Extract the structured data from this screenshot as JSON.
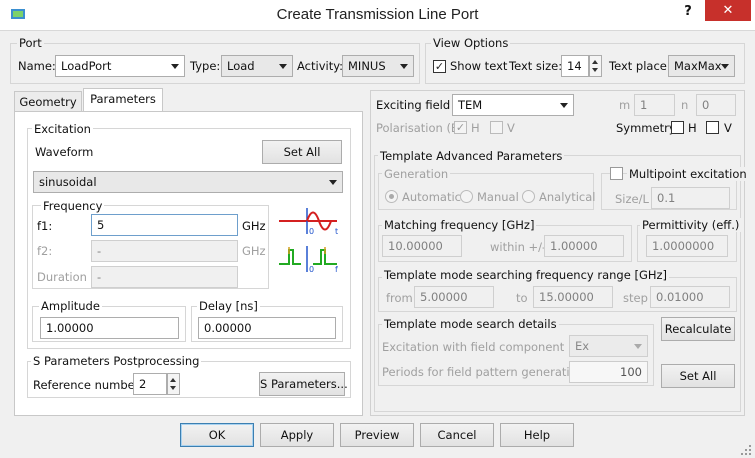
{
  "window": {
    "title": "Create Transmission Line Port",
    "help": "?",
    "close": "✕"
  },
  "port": {
    "group_label": "Port",
    "name_label": "Name:",
    "name_value": "LoadPort",
    "type_label": "Type:",
    "type_value": "Load",
    "activity_label": "Activity:",
    "activity_value": "MINUS"
  },
  "view_options": {
    "group_label": "View Options",
    "show_text_label": "Show text",
    "show_text_checked": true,
    "text_size_label": "Text size:",
    "text_size_value": "14",
    "text_place_label": "Text place:",
    "text_place_value": "MaxMax"
  },
  "tabs": [
    {
      "label": "Geometry",
      "active": false
    },
    {
      "label": "Parameters",
      "active": true
    }
  ],
  "excitation": {
    "group_label": "Excitation",
    "waveform_label": "Waveform",
    "set_all": "Set All",
    "waveform_value": "sinusoidal",
    "frequency_group": "Frequency",
    "f1_label": "f1:",
    "f1_value": "5",
    "f1_unit": "GHz",
    "f2_label": "f2:",
    "f2_value": "-",
    "f2_unit": "GHz",
    "duration_label": "Duration",
    "duration_value": "-",
    "amplitude_label": "Amplitude",
    "amplitude_value": "1.00000",
    "delay_label": "Delay [ns]",
    "delay_value": "0.00000"
  },
  "s_params": {
    "group_label": "S Parameters Postprocessing",
    "ref_label": "Reference number:",
    "ref_value": "2",
    "button": "S Parameters..."
  },
  "exciting": {
    "field_label": "Exciting field",
    "field_value": "TEM",
    "m_label": "m",
    "m_value": "1",
    "n_label": "n",
    "n_value": "0",
    "polarisation_label": "Polarisation (E)",
    "pol_h_label": "H",
    "pol_h_checked": true,
    "pol_v_label": "V",
    "pol_v_checked": false,
    "symmetry_label": "Symmetry",
    "sym_h_label": "H",
    "sym_h_checked": false,
    "sym_v_label": "V",
    "sym_v_checked": false
  },
  "template": {
    "group_label": "Template Advanced Parameters",
    "generation_label": "Generation",
    "gen_automatic": "Automatic",
    "gen_manual": "Manual",
    "gen_analytical": "Analytical",
    "gen_selected": "Automatic",
    "multipoint_label": "Multipoint excitation",
    "multipoint_checked": false,
    "size_l_label": "Size/L",
    "size_l_value": "0.1",
    "matching_label": "Matching frequency [GHz]",
    "matching_value": "10.00000",
    "within_label": "within +/-",
    "within_value": "1.00000",
    "permittivity_label": "Permittivity (eff.)",
    "permittivity_value": "1.0000000",
    "range_label": "Template mode searching frequency range [GHz]",
    "from_label": "from",
    "from_value": "5.00000",
    "to_label": "to",
    "to_value": "15.00000",
    "step_label": "step",
    "step_value": "0.01000",
    "search_label": "Template mode search details",
    "excitation_component_label": "Excitation with field component",
    "excitation_component_value": "Ex",
    "periods_label": "Periods for field pattern generation",
    "periods_value": "100",
    "recalculate": "Recalculate",
    "set_all": "Set All"
  },
  "footer": {
    "ok": "OK",
    "apply": "Apply",
    "preview": "Preview",
    "cancel": "Cancel",
    "help": "Help"
  },
  "colors": {
    "close_button": "#c7302b",
    "waveform_red": "#d42020",
    "waveform_green": "#22aa22",
    "axis_blue": "#2255cc"
  }
}
